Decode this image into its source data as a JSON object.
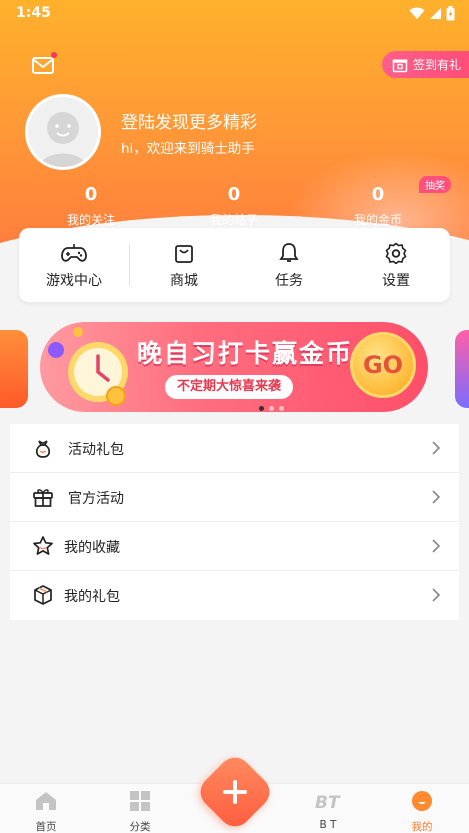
{
  "status_bar": {
    "time": "1:45"
  },
  "header": {
    "checkin_label": "签到有礼",
    "login_title": "登陆发现更多精彩",
    "login_subtitle": "hi，欢迎来到骑士助手",
    "lottery_badge": "抽奖"
  },
  "stats": [
    {
      "value": "0",
      "label": "我的关注"
    },
    {
      "value": "0",
      "label": "我的帖子"
    },
    {
      "value": "0",
      "label": "我的金币"
    }
  ],
  "quick_menu": [
    {
      "label": "游戏中心",
      "icon": "gamepad-icon"
    },
    {
      "label": "商城",
      "icon": "shopping-bag-icon"
    },
    {
      "label": "任务",
      "icon": "bell-icon"
    },
    {
      "label": "设置",
      "icon": "gear-icon"
    }
  ],
  "banner": {
    "title": "晚自习打卡赢金币",
    "pill": "不定期大惊喜来袭",
    "go_label": "GO",
    "page_count": 3,
    "active_page": 1
  },
  "menu_list": [
    {
      "label": "活动礼包",
      "icon": "gift-bag-icon"
    },
    {
      "label": "官方活动",
      "icon": "gift-box-icon"
    },
    {
      "label": "我的收藏",
      "icon": "star-icon"
    },
    {
      "label": "我的礼包",
      "icon": "package-icon"
    }
  ],
  "tab_bar": [
    {
      "label": "首页",
      "icon": "home-icon",
      "active": false
    },
    {
      "label": "分类",
      "icon": "grid-icon",
      "active": false
    },
    {
      "label": "B T",
      "icon": "bt-icon",
      "active": false
    },
    {
      "label": "我的",
      "icon": "profile-icon",
      "active": true
    }
  ],
  "colors": {
    "header_top": "#ffb12c",
    "header_bottom": "#ff7a3f",
    "accent_pink": "#ff4d79",
    "active_tab": "#ff7a30"
  }
}
